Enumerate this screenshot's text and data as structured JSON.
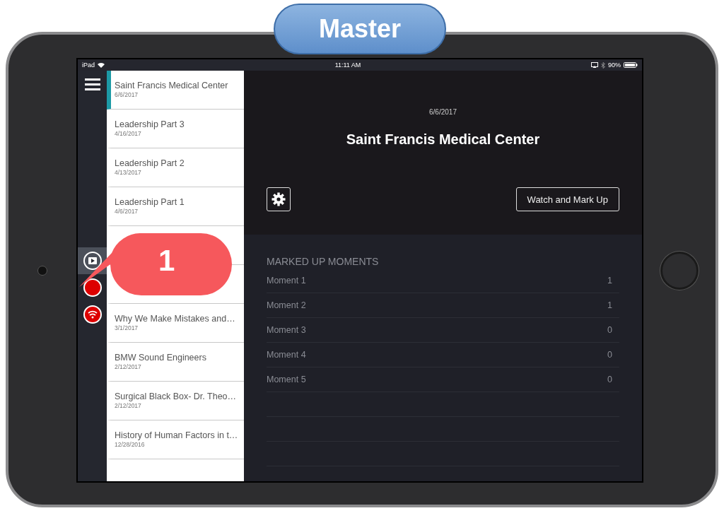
{
  "badge": {
    "label": "Master"
  },
  "status_bar": {
    "device": "iPad",
    "time": "11:11 AM",
    "battery": "90%"
  },
  "rail": {
    "items": [
      {
        "kind": "play",
        "selected": true
      },
      {
        "kind": "record",
        "selected": false
      },
      {
        "kind": "broadcast",
        "selected": false
      }
    ]
  },
  "sessions": [
    {
      "title": "Saint Francis Medical Center",
      "date": "6/6/2017",
      "selected": true
    },
    {
      "title": "Leadership Part 3",
      "date": "4/16/2017",
      "selected": false
    },
    {
      "title": "Leadership Part 2",
      "date": "4/13/2017",
      "selected": false
    },
    {
      "title": "Leadership Part 1",
      "date": "4/6/2017",
      "selected": false
    },
    {
      "selected": false
    },
    {
      "selected": false
    },
    {
      "title": "Why We Make Mistakes and…",
      "date": "3/1/2017",
      "selected": false
    },
    {
      "title": "BMW Sound Engineers",
      "date": "2/12/2017",
      "selected": false
    },
    {
      "title": "Surgical Black Box- Dr. Theo…",
      "date": "2/12/2017",
      "selected": false
    },
    {
      "title": "History of Human Factors in t…",
      "date": "12/28/2016",
      "selected": false
    }
  ],
  "detail": {
    "date": "6/6/2017",
    "title": "Saint Francis Medical Center",
    "watch_button": "Watch and Mark Up"
  },
  "moments": {
    "heading": "MARKED UP MOMENTS",
    "rows": [
      {
        "name": "Moment 1",
        "count": "1"
      },
      {
        "name": "Moment 2",
        "count": "1"
      },
      {
        "name": "Moment 3",
        "count": "0"
      },
      {
        "name": "Moment 4",
        "count": "0"
      },
      {
        "name": "Moment 5",
        "count": "0"
      }
    ]
  },
  "callout": {
    "number": "1"
  }
}
